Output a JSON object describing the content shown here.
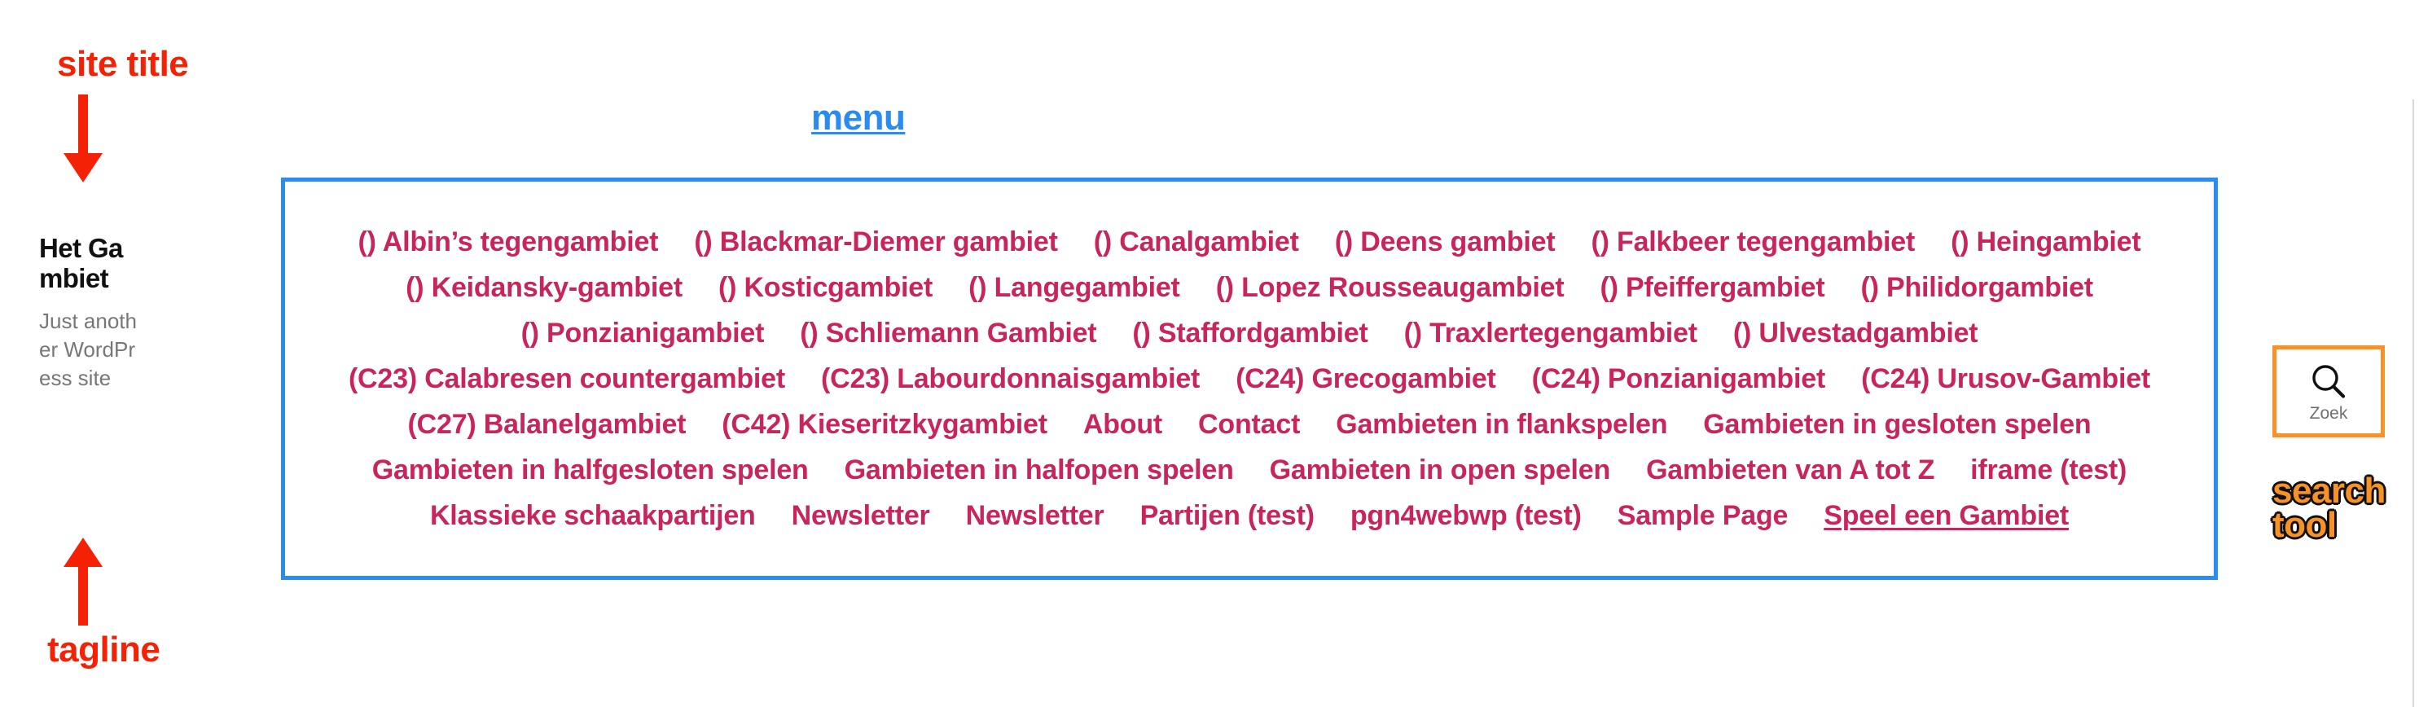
{
  "annotations": {
    "site_title_callout": "site title",
    "tagline_callout": "tagline",
    "menu_callout": "menu",
    "search_tool_callout_line1": "search",
    "search_tool_callout_line2": "tool",
    "colors": {
      "callout_red": "#f42105",
      "callout_orange": "#f79226",
      "callout_blue": "#2a8cf0",
      "menu_link": "#c8255b",
      "menu_border": "#2a8cf0",
      "search_border": "#f79226"
    }
  },
  "site_identity": {
    "title": "Het Gambiet",
    "tagline": "Just another WordPress site"
  },
  "menu": {
    "items": [
      {
        "label": "() Albin’s tegengambiet",
        "underlined": false
      },
      {
        "label": "() Blackmar-Diemer gambiet",
        "underlined": false
      },
      {
        "label": "() Canalgambiet",
        "underlined": false
      },
      {
        "label": "() Deens gambiet",
        "underlined": false
      },
      {
        "label": "() Falkbeer tegengambiet",
        "underlined": false
      },
      {
        "label": "() Heingambiet",
        "underlined": false
      },
      {
        "label": "() Keidansky-gambiet",
        "underlined": false
      },
      {
        "label": "() Kosticgambiet",
        "underlined": false
      },
      {
        "label": "() Langegambiet",
        "underlined": false
      },
      {
        "label": "() Lopez Rousseaugambiet",
        "underlined": false
      },
      {
        "label": "() Pfeiffergambiet",
        "underlined": false
      },
      {
        "label": "() Philidorgambiet",
        "underlined": false
      },
      {
        "label": "() Ponzianigambiet",
        "underlined": false
      },
      {
        "label": "() Schliemann Gambiet",
        "underlined": false
      },
      {
        "label": "() Staffordgambiet",
        "underlined": false
      },
      {
        "label": "() Traxlertegengambiet",
        "underlined": false
      },
      {
        "label": "() Ulvestadgambiet",
        "underlined": false
      },
      {
        "label": "(C23) Calabresen countergambiet",
        "underlined": false
      },
      {
        "label": "(C23) Labourdonnaisgambiet",
        "underlined": false
      },
      {
        "label": "(C24) Grecogambiet",
        "underlined": false
      },
      {
        "label": "(C24) Ponzianigambiet",
        "underlined": false
      },
      {
        "label": "(C24) Urusov-Gambiet",
        "underlined": false
      },
      {
        "label": "(C27) Balanelgambiet",
        "underlined": false
      },
      {
        "label": "(C42) Kieseritzkygambiet",
        "underlined": false
      },
      {
        "label": "About",
        "underlined": false
      },
      {
        "label": "Contact",
        "underlined": false
      },
      {
        "label": "Gambieten in flankspelen",
        "underlined": false
      },
      {
        "label": "Gambieten in gesloten spelen",
        "underlined": false
      },
      {
        "label": "Gambieten in halfgesloten spelen",
        "underlined": false
      },
      {
        "label": "Gambieten in halfopen spelen",
        "underlined": false
      },
      {
        "label": "Gambieten in open spelen",
        "underlined": false
      },
      {
        "label": "Gambieten van A tot Z",
        "underlined": false
      },
      {
        "label": "iframe (test)",
        "underlined": false
      },
      {
        "label": "Klassieke schaakpartijen",
        "underlined": false
      },
      {
        "label": "Newsletter",
        "underlined": false
      },
      {
        "label": "Newsletter",
        "underlined": false
      },
      {
        "label": "Partijen (test)",
        "underlined": false
      },
      {
        "label": "pgn4webwp (test)",
        "underlined": false
      },
      {
        "label": "Sample Page",
        "underlined": false
      },
      {
        "label": "Speel een Gambiet",
        "underlined": true
      }
    ]
  },
  "search": {
    "icon": "magnifier-icon",
    "label": "Zoek"
  }
}
